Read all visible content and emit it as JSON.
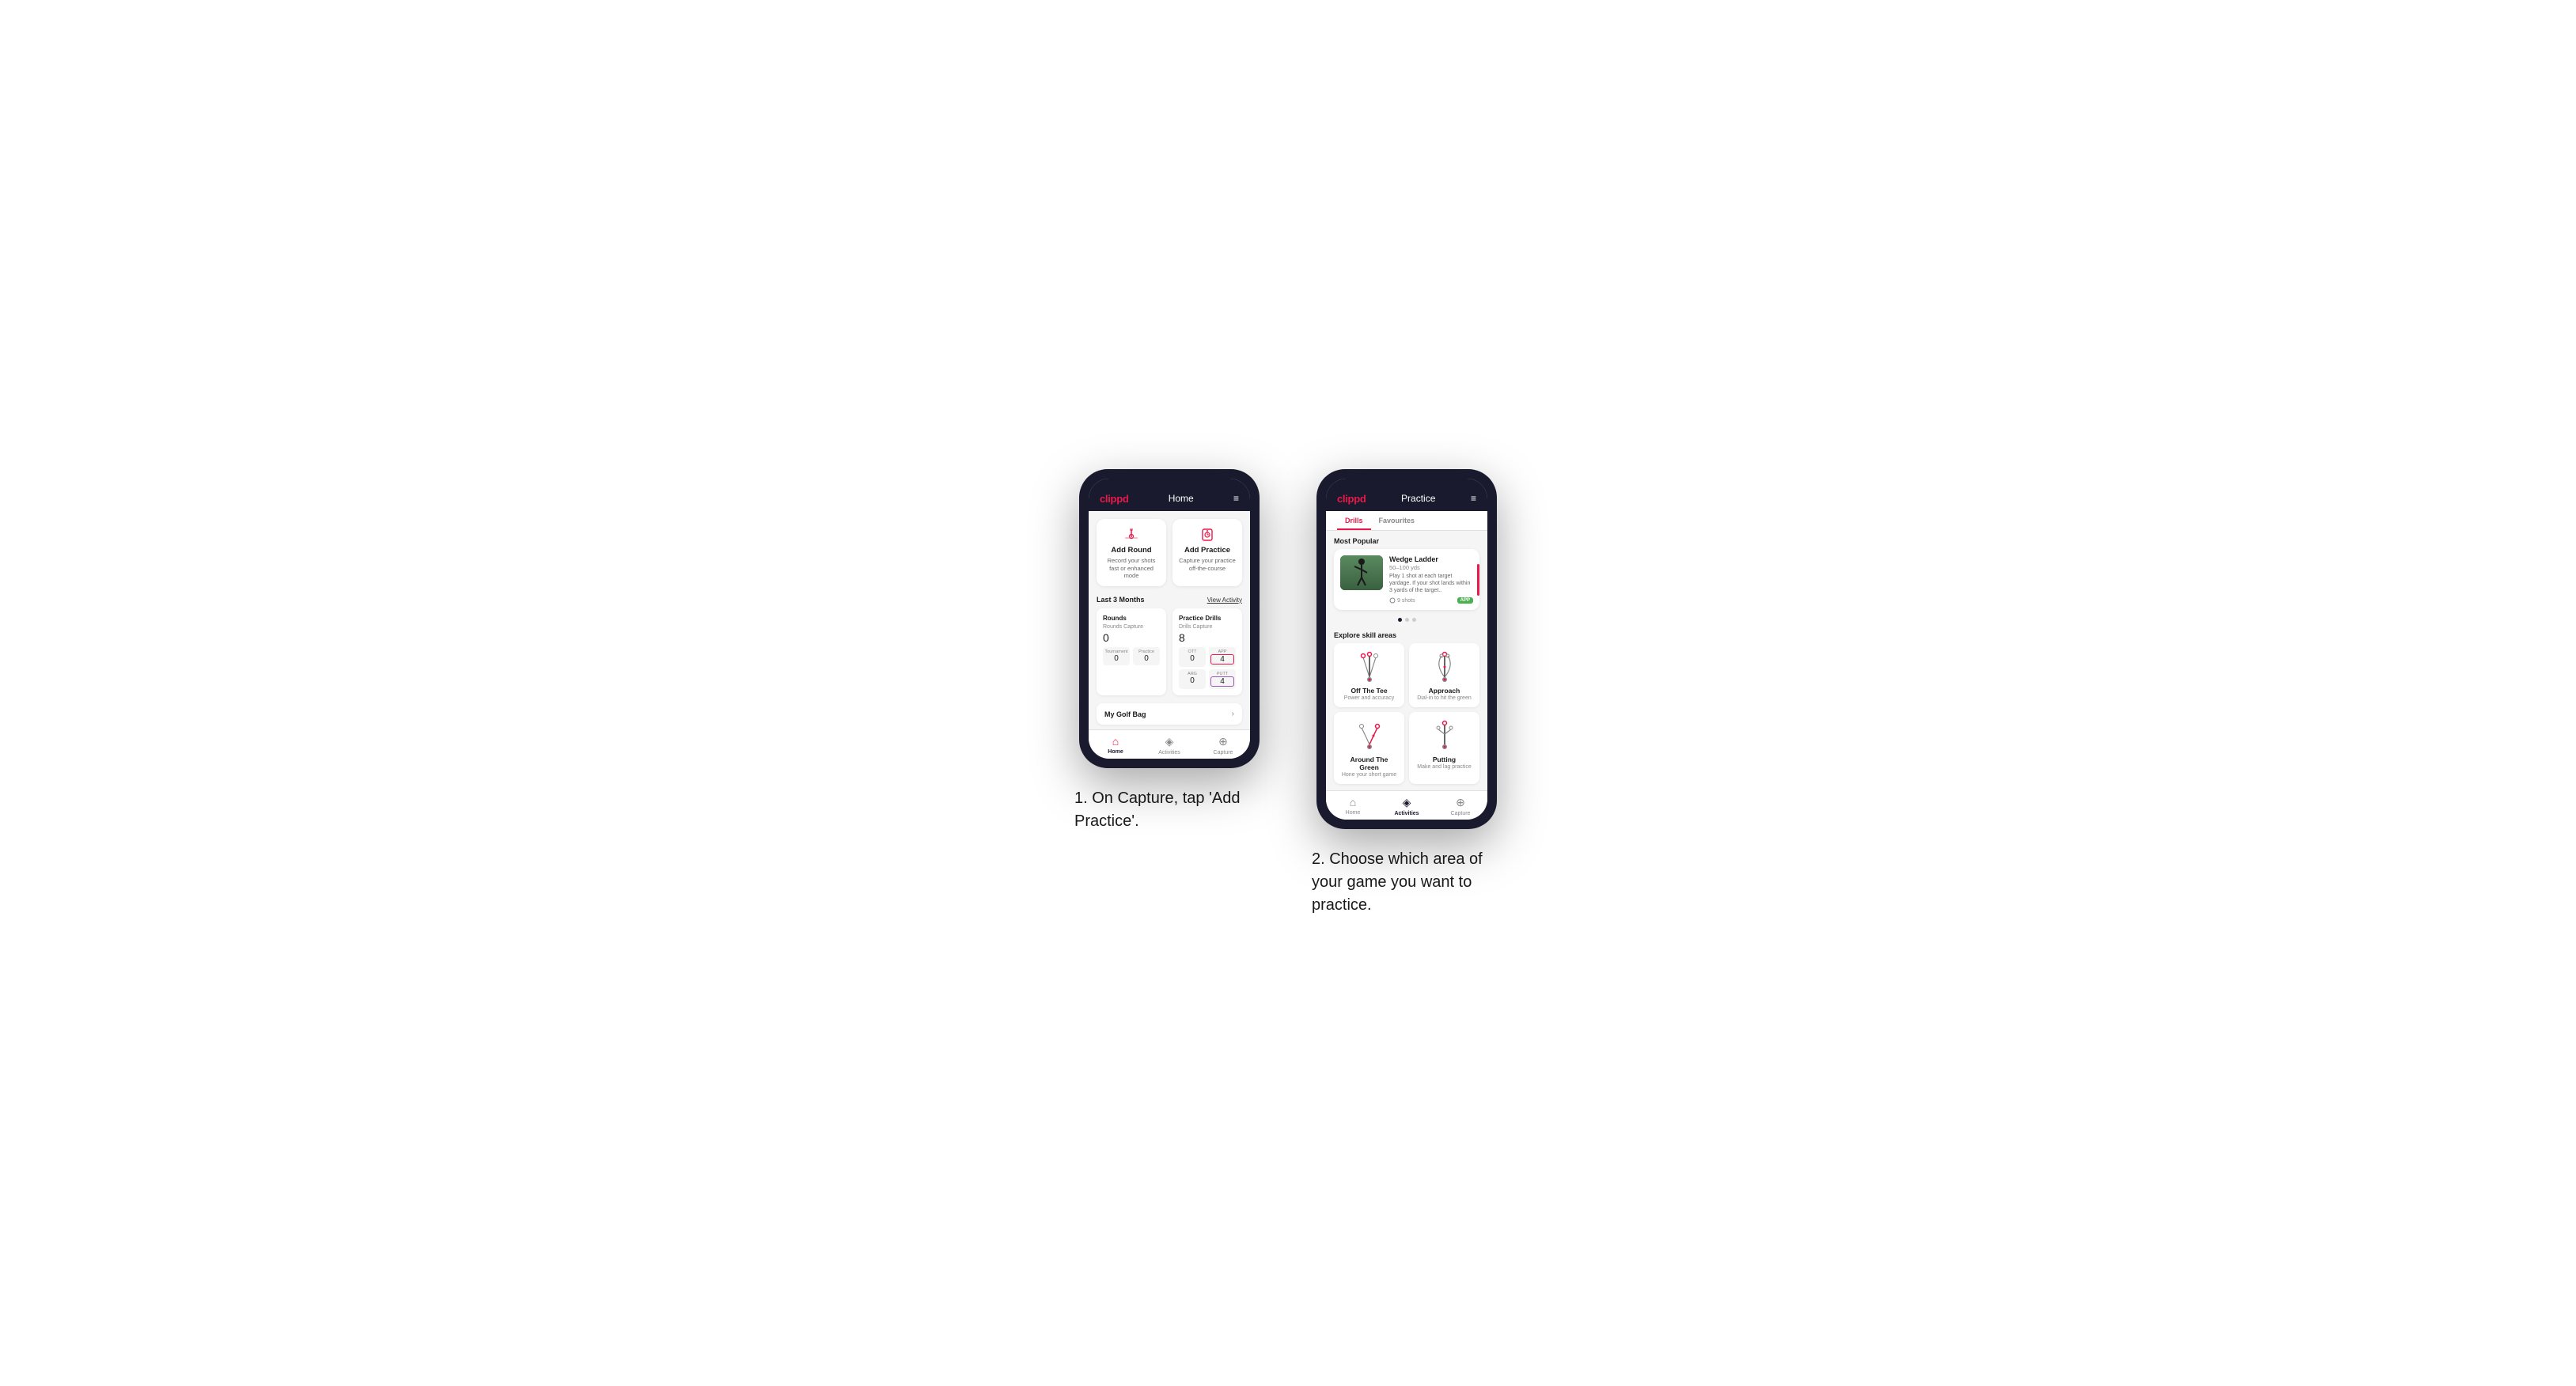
{
  "page": {
    "background": "#ffffff"
  },
  "phone1": {
    "header": {
      "logo": "clippd",
      "title": "Home",
      "menu_icon": "≡"
    },
    "action_cards": [
      {
        "id": "add-round",
        "icon": "⛳",
        "title": "Add Round",
        "desc": "Record your shots fast or enhanced mode"
      },
      {
        "id": "add-practice",
        "icon": "🎯",
        "title": "Add Practice",
        "desc": "Capture your practice off-the-course"
      }
    ],
    "stats": {
      "period": "Last 3 Months",
      "view_activity": "View Activity",
      "rounds": {
        "title": "Rounds",
        "sub_label": "Rounds Capture",
        "total": "0",
        "items": [
          {
            "label": "Tournament",
            "value": "0"
          },
          {
            "label": "Practice",
            "value": "0"
          }
        ]
      },
      "drills": {
        "title": "Practice Drills",
        "sub_label": "Drills Capture",
        "total": "8",
        "items": [
          {
            "label": "OTT",
            "value": "0",
            "style": "normal"
          },
          {
            "label": "APP",
            "value": "4",
            "style": "pink"
          },
          {
            "label": "ARG",
            "value": "0",
            "style": "normal"
          },
          {
            "label": "PUTT",
            "value": "4",
            "style": "purple"
          }
        ]
      }
    },
    "golf_bag": {
      "label": "My Golf Bag",
      "chevron": "›"
    },
    "bottom_nav": [
      {
        "id": "home",
        "icon": "⌂",
        "label": "Home",
        "active": true
      },
      {
        "id": "activities",
        "icon": "◈",
        "label": "Activities",
        "active": false
      },
      {
        "id": "capture",
        "icon": "⊕",
        "label": "Capture",
        "active": false
      }
    ]
  },
  "phone2": {
    "header": {
      "logo": "clippd",
      "title": "Practice",
      "menu_icon": "≡"
    },
    "tabs": [
      {
        "label": "Drills",
        "active": true
      },
      {
        "label": "Favourites",
        "active": false
      }
    ],
    "most_popular": {
      "section_title": "Most Popular",
      "card": {
        "title": "Wedge Ladder",
        "yardage": "50–100 yds",
        "desc": "Play 1 shot at each target yardage. If your shot lands within 3 yards of the target..",
        "shots": "9 shots",
        "badge": "APP"
      }
    },
    "explore": {
      "section_title": "Explore skill areas",
      "skills": [
        {
          "id": "off-the-tee",
          "title": "Off The Tee",
          "desc": "Power and accuracy",
          "diagram": "ott"
        },
        {
          "id": "approach",
          "title": "Approach",
          "desc": "Dial-in to hit the green",
          "diagram": "approach"
        },
        {
          "id": "around-the-green",
          "title": "Around The Green",
          "desc": "Hone your short game",
          "diagram": "atg"
        },
        {
          "id": "putting",
          "title": "Putting",
          "desc": "Make and lag practice",
          "diagram": "putting"
        }
      ]
    },
    "bottom_nav": [
      {
        "id": "home",
        "icon": "⌂",
        "label": "Home",
        "active": false
      },
      {
        "id": "activities",
        "icon": "◈",
        "label": "Activities",
        "active": true
      },
      {
        "id": "capture",
        "icon": "⊕",
        "label": "Capture",
        "active": false
      }
    ]
  },
  "captions": {
    "phone1": "1. On Capture, tap 'Add Practice'.",
    "phone2": "2. Choose which area of your game you want to practice."
  }
}
